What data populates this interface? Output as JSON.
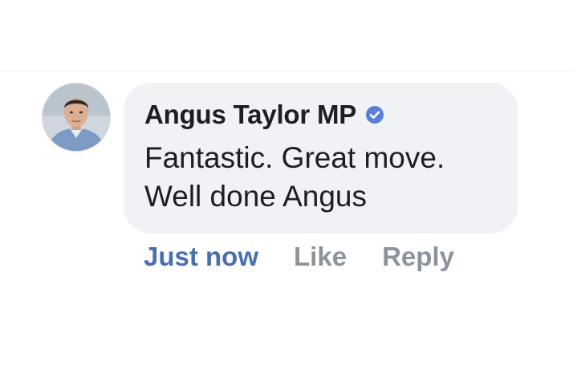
{
  "comment": {
    "author": "Angus Taylor MP",
    "verified": true,
    "verified_icon": "verified-badge-icon",
    "text_lines": [
      "Fantastic. Great move.",
      "Well done Angus"
    ],
    "timestamp": "Just now",
    "like_label": "Like",
    "reply_label": "Reply"
  },
  "colors": {
    "bubble_background": "#f0f2f5",
    "author_text": "#1c1e21",
    "timestamp_link": "#4a6fae",
    "action_link": "#8c939c",
    "verified_badge": "#5b7fd6"
  }
}
